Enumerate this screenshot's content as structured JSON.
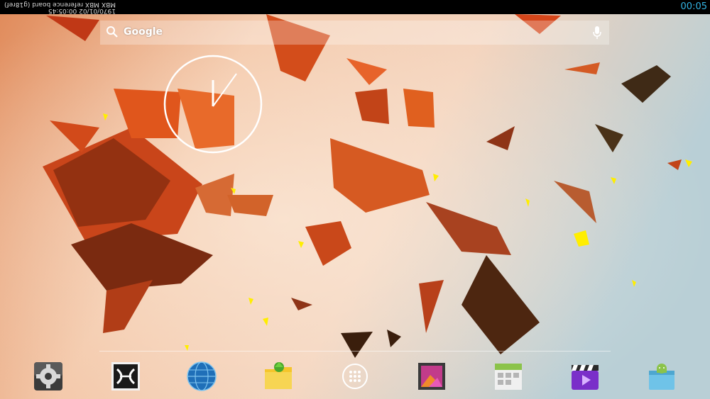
{
  "status_bar": {
    "device_name": "MBX MBX reference board (g18ref)",
    "datetime": "1970/01/02 00:05:45",
    "clock": "00:05"
  },
  "search": {
    "label": "Google"
  },
  "dock": {
    "apps": [
      {
        "icon": "settings-icon"
      },
      {
        "icon": "xbmc-icon"
      },
      {
        "icon": "browser-globe-icon"
      },
      {
        "icon": "file-manager-icon"
      },
      {
        "icon": "all-apps-icon"
      },
      {
        "icon": "gallery-icon"
      },
      {
        "icon": "calendar-icon"
      },
      {
        "icon": "video-player-icon"
      },
      {
        "icon": "app-installer-icon"
      }
    ]
  },
  "colors": {
    "clock_accent": "#33b5e5",
    "status_bar_bg": "#000000",
    "shard_orange": "#d6541c",
    "shard_dark": "#4a2a12",
    "confetti_yellow": "#ffee00"
  }
}
